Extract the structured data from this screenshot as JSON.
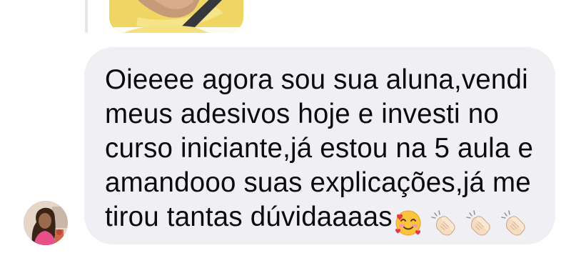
{
  "conversation": {
    "previous_message": {
      "kind": "image",
      "thumbnail_icon": "photo-thumbnail-yellow-shirt"
    },
    "message": {
      "lines": [
        "Oieeee agora sou sua aluna,vendi",
        "meus adesivos hoje e investi no",
        "curso iniciante,já estou na 5 aula e",
        "amandooo suas explicações,já me",
        "tirou tantas dúvidaaaas"
      ],
      "emojis": [
        "smiling-face-with-hearts-emoji",
        "clapping-hands-emoji",
        "clapping-hands-emoji",
        "clapping-hands-emoji"
      ],
      "bubble_color": "#efeff4",
      "text_color": "#0b0b0b"
    },
    "sender": {
      "avatar_icon": "user-avatar"
    }
  }
}
